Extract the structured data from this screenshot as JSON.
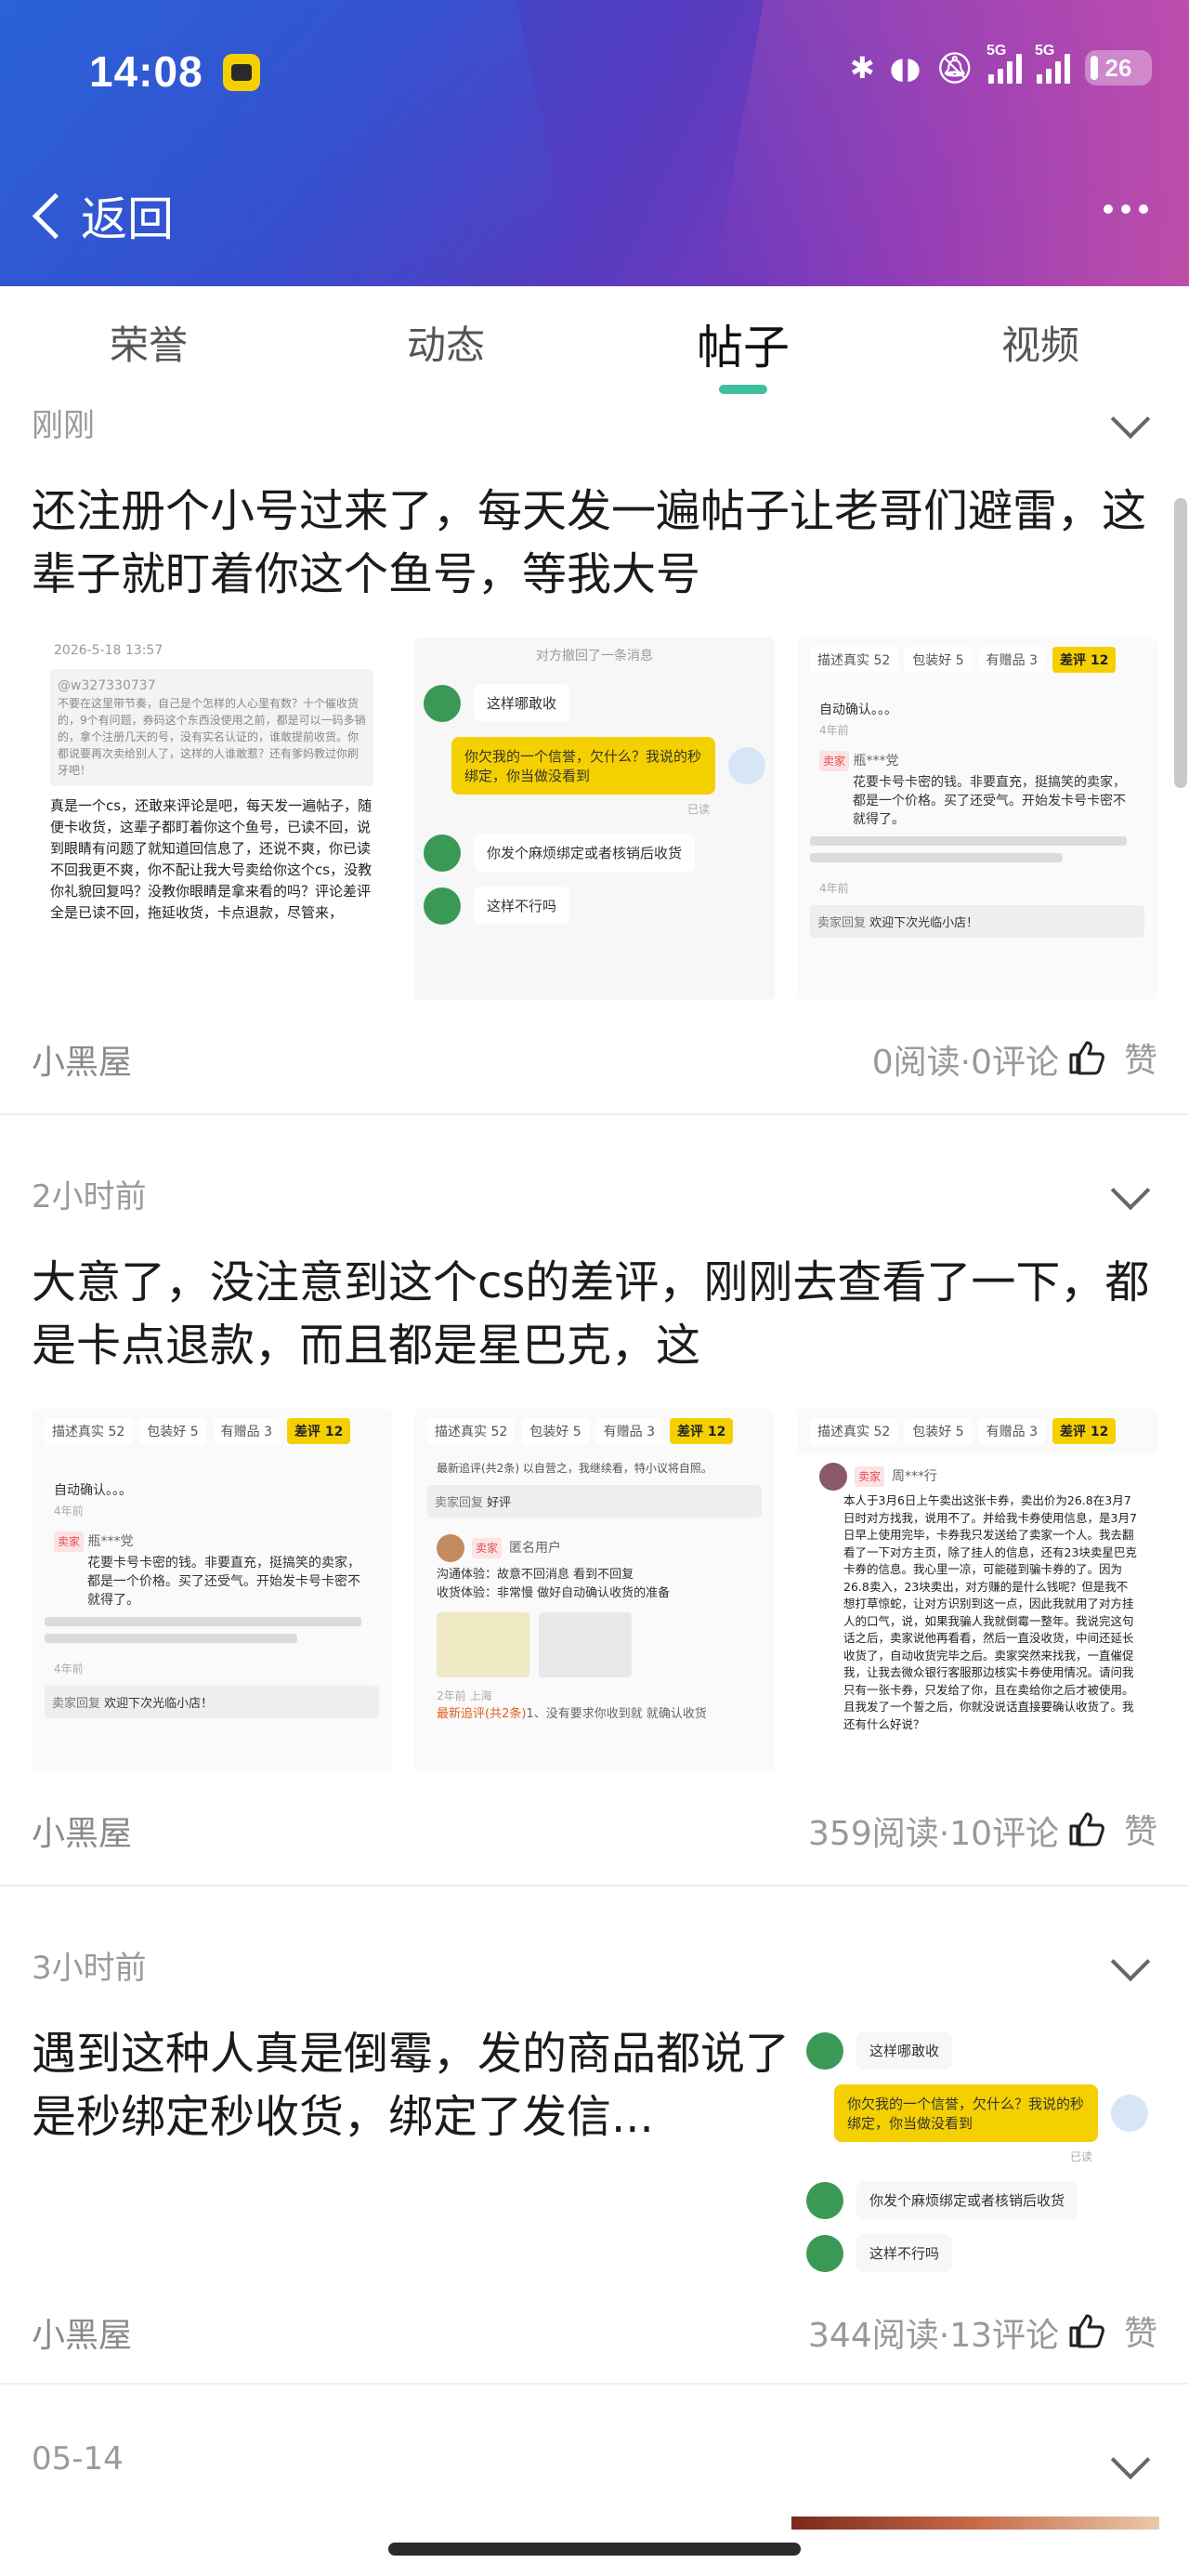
{
  "status_bar": {
    "time": "14:08",
    "badge_icon": "app-badge-icon",
    "net1": "5G",
    "net2": "5G",
    "battery": "26"
  },
  "header": {
    "back_label": "返回",
    "more_icon": "more-dots-icon"
  },
  "tabs": [
    {
      "label": "荣誉",
      "active": false
    },
    {
      "label": "动态",
      "active": false
    },
    {
      "label": "帖子",
      "active": true
    },
    {
      "label": "视频",
      "active": false
    }
  ],
  "accent_color": "#3fbf9c",
  "posts": [
    {
      "time": "刚刚",
      "title": "还注册个小号过来了，每天发一遍帖子让老哥们避雷，这辈子就盯着你这个鱼号，等我大号",
      "author": "小黑屋",
      "stats": "0阅读·0评论",
      "like_label": "赞",
      "images": [
        {
          "date": "2026-5-18 13:57",
          "quote_user": "@w327330737",
          "quote": "不要在这里带节奏，自己是个怎样的人心里有数？十个催收货的，9个有问题，券码这个东西没使用之前，都是可以一码多销的，拿个注册几天的号，没有实名认证的，谁敢提前收货。你都说要再次卖给别人了，这样的人谁敢惹？还有爹妈教过你刷牙吧！",
          "body": "真是一个cs，还敢来评论是吧，每天发一遍帖子，随便卡收货，这辈子都盯着你这个鱼号，已读不回，说到眼睛有问题了就知道回信息了，还说不爽，你已读不回我更不爽，你不配让我大号卖给你这个cs，没教你礼貌回复吗？没教你眼睛是拿来看的吗？评论差评全是已读不回，拖延收货，卡点退款，尽管来，"
        },
        {
          "system": "对方撤回了一条消息",
          "msg1": "这样哪敢收",
          "msg2": "你欠我的一个信誉，欠什么？我说的秒绑定，你当做没看到",
          "read": "已读",
          "msg3": "你发个麻烦绑定或者核销后收货",
          "msg4": "这样不行吗"
        },
        {
          "tags": [
            "描述真实 52",
            "包装好 5",
            "有赠品 3",
            "差评 12"
          ],
          "auto": "自动确认。。。",
          "ago": "4年前",
          "seller": "卖家",
          "buyer": "瓶***党",
          "review": "花要卡号卡密的钱。非要直充，挺搞笑的卖家，都是一个价格。买了还受气。开始发卡号卡密不就得了。",
          "ago2": "4年前",
          "reply_label": "卖家回复",
          "reply": "欢迎下次光临小店！"
        }
      ]
    },
    {
      "time": "2小时前",
      "title": "大意了，没注意到这个cs的差评，刚刚去查看了一下，都是卡点退款，而且都是星巴克，这",
      "author": "小黑屋",
      "stats": "359阅读·10评论",
      "like_label": "赞",
      "images": [
        {
          "tags": [
            "描述真实 52",
            "包装好 5",
            "有赠品 3",
            "差评 12"
          ],
          "auto": "自动确认。。。",
          "ago": "4年前",
          "seller": "卖家",
          "buyer": "瓶***党",
          "review": "花要卡号卡密的钱。非要直充，挺搞笑的卖家，都是一个价格。买了还受气。开始发卡号卡密不就得了。",
          "ago2": "4年前",
          "reply_label": "卖家回复",
          "reply": "欢迎下次光临小店！"
        },
        {
          "tags": [
            "描述真实 52",
            "包装好 5",
            "有赠品 3",
            "差评 12"
          ],
          "top": "最新追评(共2条) 以自营之，我继续看，特小议将自照。",
          "reply_label": "卖家回复",
          "reply": "好评",
          "anon": "匿名用户",
          "seller": "卖家",
          "comm": "沟通体验：故意不回消息 看到不回复",
          "recv": "收货体验：非常慢 做好自动确认收货的准备",
          "ago": "2年前 上海",
          "latest": "最新追评(共2条)",
          "latest_text": "1、没有要求你收到就 就确认收货"
        },
        {
          "tags": [
            "描述真实 52",
            "包装好 5",
            "有赠品 3",
            "差评 12"
          ],
          "seller": "卖家",
          "buyer": "周***行",
          "review": "本人于3月6日上午卖出这张卡券，卖出价为26.8在3月7日时对方找我，说用不了。并给我卡券使用信息，是3月7日早上使用完毕，卡券我只发送给了卖家一个人。我去翻看了一下对方主页，除了挂人的信息，还有23块卖星巴克卡券的信息。我心里一凉，可能碰到骗卡券的了。因为26.8卖入，23块卖出，对方赚的是什么钱呢？但是我不想打草惊蛇，让对方识别到这一点，因此我就用了对方挂人的口气，说，如果我骗人我就倒霉一整年。我说完这句话之后，卖家说他再看看，然后一直没收货，中间还延长收货了，自动收货完毕之后。卖家突然来找我，一直催促我，让我去微众银行客服那边核实卡券使用情况。请问我只有一张卡券，只发给了你，且在卖给你之后才被使用。且我发了一个誓之后，你就没说话直接要确认收货了。我还有什么好说？"
        }
      ]
    },
    {
      "time": "3小时前",
      "title": "遇到这种人真是倒霉，发的商品都说了是秒绑定秒收货，绑定了发信...",
      "author": "小黑屋",
      "stats": "344阅读·13评论",
      "like_label": "赞",
      "images": [
        {
          "msg1": "这样哪敢收",
          "msg2": "你欠我的一个信誉，欠什么？我说的秒绑定，你当做没看到",
          "read": "已读",
          "msg3": "你发个麻烦绑定或者核销后收货",
          "msg4": "这样不行吗"
        }
      ]
    },
    {
      "time": "05-14"
    }
  ]
}
